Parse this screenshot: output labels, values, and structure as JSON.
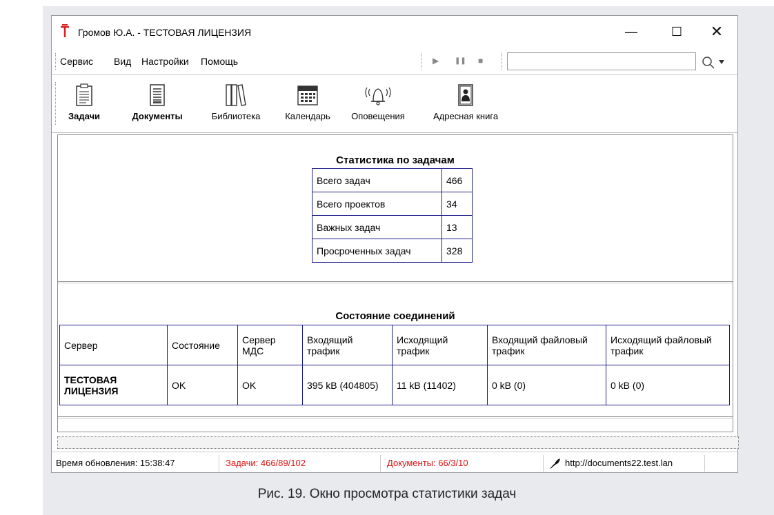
{
  "window": {
    "title": "Громов Ю.А. - ТЕСТОВАЯ ЛИЦЕНЗИЯ",
    "minimize": "—",
    "maximize": "☐",
    "close": "✕"
  },
  "menu": {
    "items": [
      "Сервис",
      "Вид",
      "Настройки",
      "Помощь"
    ]
  },
  "playback": {
    "play": "▶",
    "pause": "❚❚",
    "stop": "■"
  },
  "search": {
    "value": ""
  },
  "toolbar": {
    "items": [
      "Задачи",
      "Документы",
      "Библиотека",
      "Календарь",
      "Оповещения",
      "Адресная книга"
    ]
  },
  "stats": {
    "title": "Статистика по задачам",
    "rows": [
      {
        "label": "Всего задач",
        "value": "466"
      },
      {
        "label": "Всего проектов",
        "value": "34"
      },
      {
        "label": "Важных задач",
        "value": "13"
      },
      {
        "label": "Просроченных задач",
        "value": "328"
      }
    ]
  },
  "connections": {
    "title": "Состояние соединений",
    "headers": [
      "Сервер",
      "Состояние",
      "Сервер МДС",
      "Входящий трафик",
      "Исходящий трафик",
      "Входящий файловый трафик",
      "Исходящий файловый трафик"
    ],
    "row": [
      "ТЕСТОВАЯ ЛИЦЕНЗИЯ",
      "OK",
      "OK",
      "395 kB (404805)",
      "11 kB (11402)",
      "0 kB (0)",
      "0 kB (0)"
    ]
  },
  "status": {
    "updated": "Время обновления: 15:38:47",
    "tasks": "Задачи: 466/89/102",
    "documents": "Документы: 66/3/10",
    "server": "http://documents22.test.lan"
  },
  "caption": "Рис. 19. Окно просмотра статистики задач",
  "colors": {
    "table_border": "#1e1e8c",
    "status_red": "#e01010",
    "app_icon": "#d42020"
  }
}
